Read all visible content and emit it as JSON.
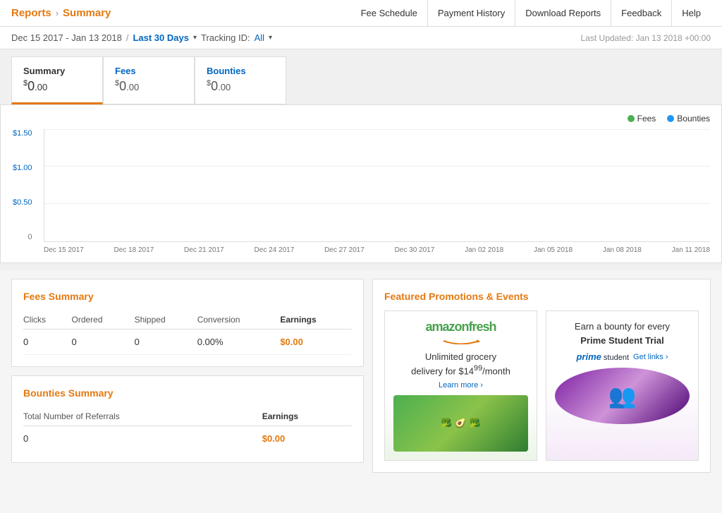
{
  "topNav": {
    "reports_label": "Reports",
    "arrow": "›",
    "summary_label": "Summary",
    "links": [
      {
        "label": "Fee Schedule",
        "name": "fee-schedule-link"
      },
      {
        "label": "Payment History",
        "name": "payment-history-link"
      },
      {
        "label": "Download Reports",
        "name": "download-reports-link"
      },
      {
        "label": "Feedback",
        "name": "feedback-link"
      },
      {
        "label": "Help",
        "name": "help-link"
      }
    ]
  },
  "filterBar": {
    "date_range": "Dec 15 2017 - Jan 13 2018",
    "slash": "/",
    "last30": "Last 30 Days",
    "tracking_label": "Tracking ID:",
    "tracking_value": "All",
    "last_updated": "Last Updated: Jan 13 2018 +00:00"
  },
  "summaryCards": {
    "summary": {
      "label": "Summary",
      "value_prefix": "$",
      "value_whole": "0",
      "value_cents": ".00"
    },
    "fees": {
      "label": "Fees",
      "value_prefix": "$",
      "value_whole": "0",
      "value_cents": ".00"
    },
    "bounties": {
      "label": "Bounties",
      "value_prefix": "$",
      "value_whole": "0",
      "value_cents": ".00"
    }
  },
  "chart": {
    "legend": {
      "fees_label": "Fees",
      "bounties_label": "Bounties"
    },
    "y_labels": [
      "$1.50",
      "$1.00",
      "$0.50",
      "0"
    ],
    "x_labels": [
      "Dec 15 2017",
      "Dec 18 2017",
      "Dec 21 2017",
      "Dec 24 2017",
      "Dec 27 2017",
      "Dec 30 2017",
      "Jan 02 2018",
      "Jan 05 2018",
      "Jan 08 2018",
      "Jan 11 2018"
    ]
  },
  "feesSummary": {
    "title": "Fees Summary",
    "columns": [
      "Clicks",
      "Ordered",
      "Shipped",
      "Conversion",
      "Earnings"
    ],
    "values": {
      "clicks": "0",
      "ordered": "0",
      "shipped": "0",
      "conversion": "0.00%",
      "earnings": "$0.00"
    }
  },
  "bountiesSummary": {
    "title": "Bounties Summary",
    "referrals_label": "Total Number of Referrals",
    "earnings_label": "Earnings",
    "referrals_value": "0",
    "earnings_value": "$0.00"
  },
  "featuredPromotions": {
    "title": "Featured Promotions & Events",
    "promos": [
      {
        "name": "amazonfresh",
        "brand": "amazonfresh",
        "text": "Unlimited grocery delivery for $14",
        "text2": "99/month",
        "learn_more": "Learn more ›",
        "veggies": "🥦🥑🥦"
      },
      {
        "name": "prime-student",
        "line1": "Earn a bounty for every",
        "line2": "Prime Student Trial",
        "logo_text": "prime student",
        "get_links": "Get links ›",
        "people": "👥"
      }
    ]
  }
}
